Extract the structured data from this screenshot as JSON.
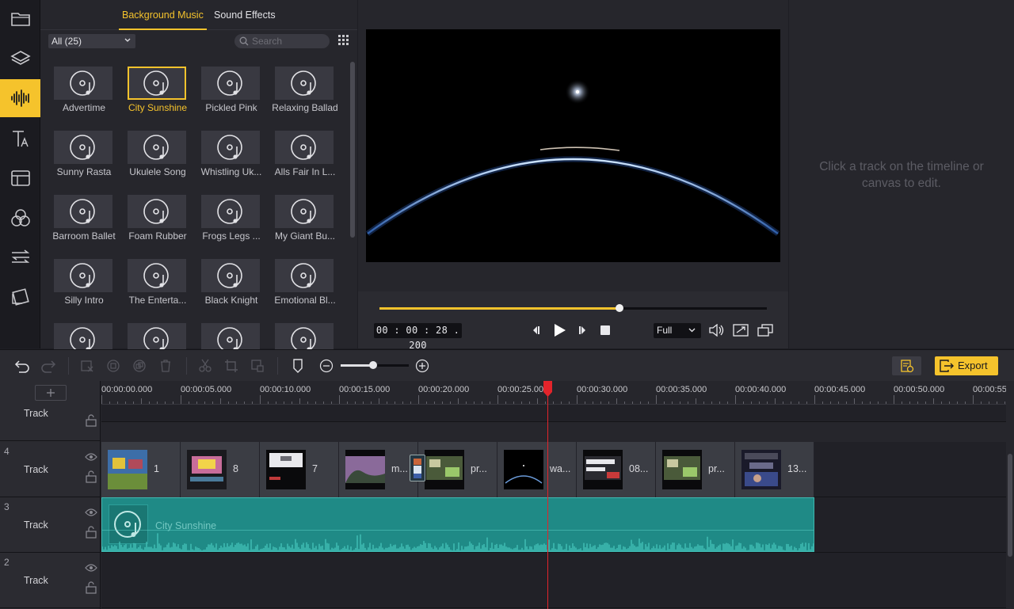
{
  "rail": {
    "items": [
      {
        "name": "media-folder",
        "icon": "folder-icon"
      },
      {
        "name": "layers",
        "icon": "layers-icon"
      },
      {
        "name": "audio",
        "icon": "audio-wave-icon",
        "active": true
      },
      {
        "name": "text",
        "icon": "text-icon"
      },
      {
        "name": "templates",
        "icon": "template-icon"
      },
      {
        "name": "filters",
        "icon": "filter-circles-icon"
      },
      {
        "name": "transitions",
        "icon": "transition-arrows-icon"
      },
      {
        "name": "overlays",
        "icon": "overlay-icon"
      }
    ],
    "accent": "#f5c32c"
  },
  "library": {
    "tabs": [
      "Background Music",
      "Sound Effects"
    ],
    "active_tab": 0,
    "filter": "All (25)",
    "search_placeholder": "Search",
    "items": [
      "Advertime",
      "City Sunshine",
      "Pickled Pink",
      "Relaxing Ballad",
      "Sunny Rasta",
      "Ukulele Song",
      "Whistling Uk...",
      "Alls Fair In L...",
      "Barroom Ballet",
      "Foam Rubber",
      "Frogs Legs ...",
      "My Giant Bu...",
      "Silly Intro",
      "The Enterta...",
      "Black Knight",
      "Emotional Bl...",
      "",
      "",
      "",
      ""
    ],
    "selected_index": 1
  },
  "preview": {
    "timecode": "00 : 00 : 28 . 200",
    "progress": 0.62,
    "quality": "Full"
  },
  "properties": {
    "hint": "Click a track on the timeline or canvas to edit."
  },
  "toolbar": {
    "export_label": "Export",
    "zoom": 0.48
  },
  "timeline": {
    "ruler_labels": [
      "00:00:00.000",
      "00:00:05.000",
      "00:00:10.000",
      "00:00:15.000",
      "00:00:20.000",
      "00:00:25.000",
      "00:00:30.000",
      "00:00:35.000",
      "00:00:40.000",
      "00:00:45.000",
      "00:00:50.000",
      "00:00:55"
    ],
    "playhead_time": "00:00:28.200",
    "tracks": [
      {
        "number": "",
        "name": "Track"
      },
      {
        "number": "4",
        "name": "Track"
      },
      {
        "number": "3",
        "name": "Track"
      },
      {
        "number": "2",
        "name": "Track"
      }
    ],
    "video_clips": [
      "1",
      "8",
      "7",
      "m...",
      "pr...",
      "wa...",
      "08...",
      "pr...",
      "13..."
    ],
    "audio_clip": "City Sunshine"
  }
}
